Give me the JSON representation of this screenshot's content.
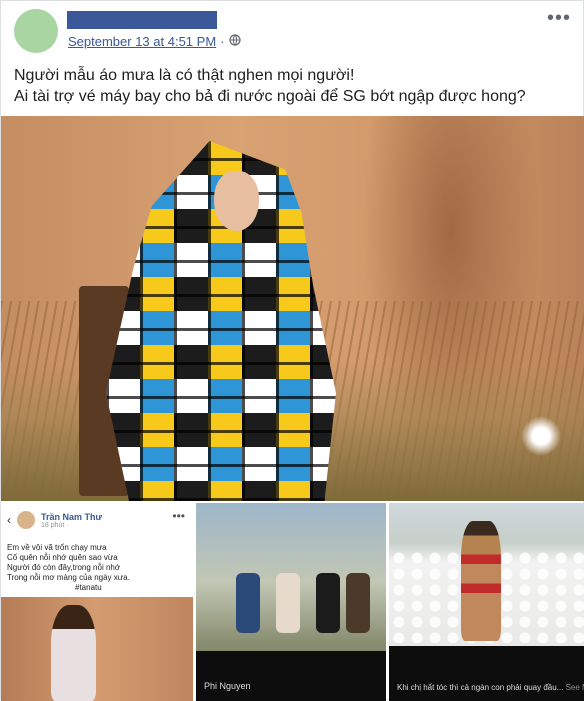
{
  "post": {
    "timestamp": "September 13 at 4:51 PM",
    "separator": "·",
    "privacy_icon": "globe-icon",
    "more_label": "•••",
    "caption_line1": "Người mẫu áo mưa là có thật nghen mọi người!",
    "caption_line2": "Ai tài trợ vé máy bay cho bả đi nước ngoài để SG bớt ngập được hong?"
  },
  "thumb1": {
    "back": "‹",
    "author": "Trần Nam Thư",
    "sub": "18 phút · ",
    "more": "•••",
    "poem": [
      "Em về vội vã trốn chạy mưa",
      "Cố quên nỗi nhớ quên sao vừa",
      "Người đó còn đây,trong nỗi nhớ",
      "Trong nỗi mơ màng của ngày xưa.",
      "#tanatu"
    ]
  },
  "thumb2": {
    "label": "Phi Nguyen"
  },
  "thumb3": {
    "label": "Khi chị hất tóc thì cả ngàn con phải quay đầu...",
    "see_more": "See More"
  },
  "colors": {
    "link": "#385898",
    "meta": "#606770",
    "name_bar": "#3b5998"
  }
}
